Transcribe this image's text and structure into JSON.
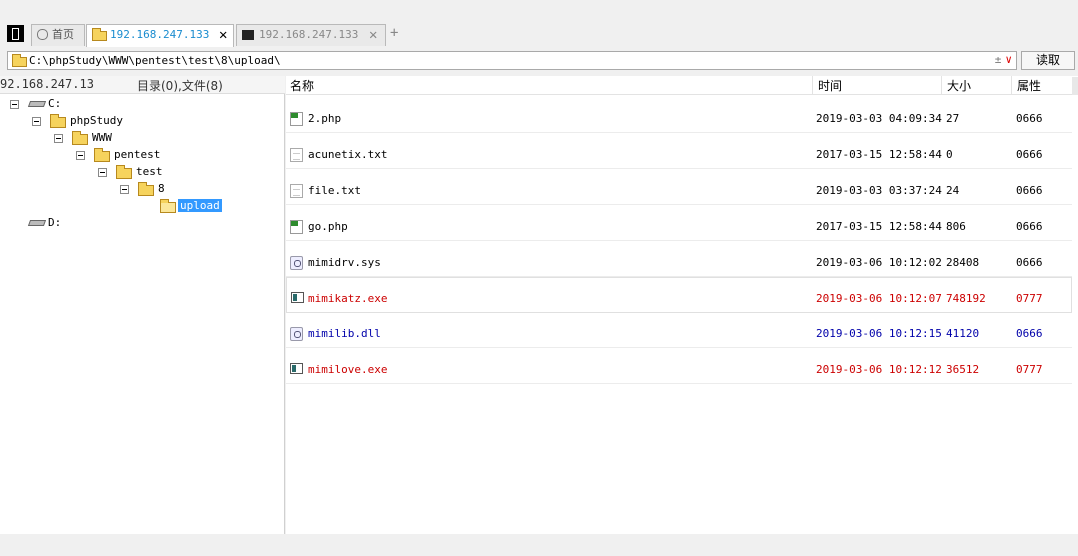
{
  "tabs": [
    {
      "label": "首页",
      "icon": "home-icon"
    },
    {
      "label": "192.168.247.133",
      "icon": "folder-icon",
      "close": "✕"
    },
    {
      "label": "192.168.247.133",
      "icon": "terminal-icon",
      "close": "✕"
    }
  ],
  "new_tab": "+",
  "address": {
    "path": "C:\\phpStudy\\WWW\\pentest\\test\\8\\upload\\",
    "ctrl": "±",
    "dropdown": "∨"
  },
  "read_button": "读取",
  "left_panel": {
    "host": "92.168.247.13",
    "summary": "目录(0),文件(8)",
    "tree": [
      {
        "label": "C:",
        "type": "drive"
      },
      {
        "label": "phpStudy",
        "type": "folder"
      },
      {
        "label": "WWW",
        "type": "folder"
      },
      {
        "label": "pentest",
        "type": "folder"
      },
      {
        "label": "test",
        "type": "folder"
      },
      {
        "label": "8",
        "type": "folder"
      },
      {
        "label": "upload",
        "type": "folder-selected"
      },
      {
        "label": "D:",
        "type": "drive"
      }
    ]
  },
  "columns": {
    "name": "名称",
    "time": "时间",
    "size": "大小",
    "attr": "属性"
  },
  "files": [
    {
      "name": "2.php",
      "time": "2019-03-03 04:09:34",
      "size": "27",
      "attr": "0666",
      "icon": "php-file-icon",
      "color": "#000000"
    },
    {
      "name": "acunetix.txt",
      "time": "2017-03-15 12:58:44",
      "size": "0",
      "attr": "0666",
      "icon": "text-file-icon",
      "color": "#000000"
    },
    {
      "name": "file.txt",
      "time": "2019-03-03 03:37:24",
      "size": "24",
      "attr": "0666",
      "icon": "text-file-icon",
      "color": "#000000"
    },
    {
      "name": "go.php",
      "time": "2017-03-15 12:58:44",
      "size": "806",
      "attr": "0666",
      "icon": "php-file-icon",
      "color": "#000000"
    },
    {
      "name": "mimidrv.sys",
      "time": "2019-03-06 10:12:02",
      "size": "28408",
      "attr": "0666",
      "icon": "system-file-icon",
      "color": "#000000"
    },
    {
      "name": "mimikatz.exe",
      "time": "2019-03-06 10:12:07",
      "size": "748192",
      "attr": "0777",
      "icon": "exe-file-icon",
      "color": "#cc0000"
    },
    {
      "name": "mimilib.dll",
      "time": "2019-03-06 10:12:15",
      "size": "41120",
      "attr": "0666",
      "icon": "system-file-icon",
      "color": "#0000aa"
    },
    {
      "name": "mimilove.exe",
      "time": "2019-03-06 10:12:12",
      "size": "36512",
      "attr": "0777",
      "icon": "exe-file-icon",
      "color": "#cc0000"
    }
  ]
}
